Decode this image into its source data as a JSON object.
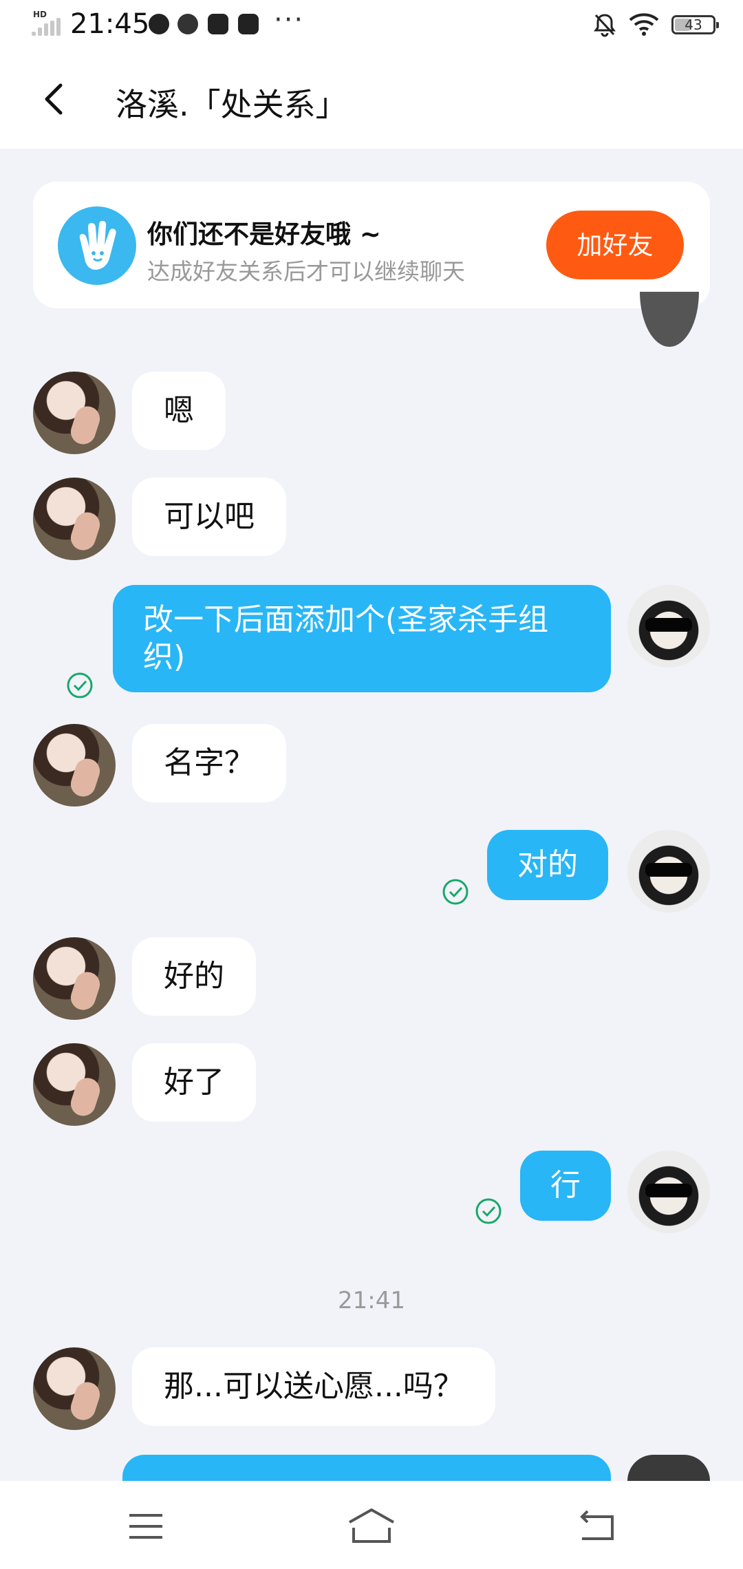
{
  "status_bar": {
    "time": "21:45",
    "signal_badge": "HD",
    "battery": "43",
    "icons": [
      "signal-icon",
      "app-icon",
      "app-icon",
      "app-icon",
      "app-icon",
      "more-dots-icon",
      "mute-bell-icon",
      "wifi-icon",
      "battery-icon"
    ]
  },
  "header": {
    "title": "洛溪.「处关系」",
    "back_icon": "chevron-left-icon"
  },
  "friend_card": {
    "title": "你们还不是好友哦 ~",
    "subtitle": "达成好友关系后才可以继续聊天",
    "add_button": "加好友",
    "icon": "waving-hand-icon"
  },
  "messages": [
    {
      "side": "left",
      "text": "嗯"
    },
    {
      "side": "left",
      "text": "可以吧"
    },
    {
      "side": "right",
      "text": "改一下后面添加个(圣家杀手组织)",
      "status": "read"
    },
    {
      "side": "left",
      "text": "名字？"
    },
    {
      "side": "right",
      "text": "对的",
      "status": "read"
    },
    {
      "side": "left",
      "text": "好的"
    },
    {
      "side": "left",
      "text": "好了"
    },
    {
      "side": "right",
      "text": "行",
      "status": "read"
    },
    {
      "side": "left",
      "text": "那...可以送心愿...吗？"
    }
  ],
  "timestamp": "21:41",
  "nav_bar": {
    "icons": [
      "menu-icon",
      "home-icon",
      "back-icon"
    ]
  },
  "colors": {
    "accent": "#28b6f6",
    "add_button": "#ff5a12",
    "background": "#f1f3f8",
    "read_check": "#18a86a"
  }
}
